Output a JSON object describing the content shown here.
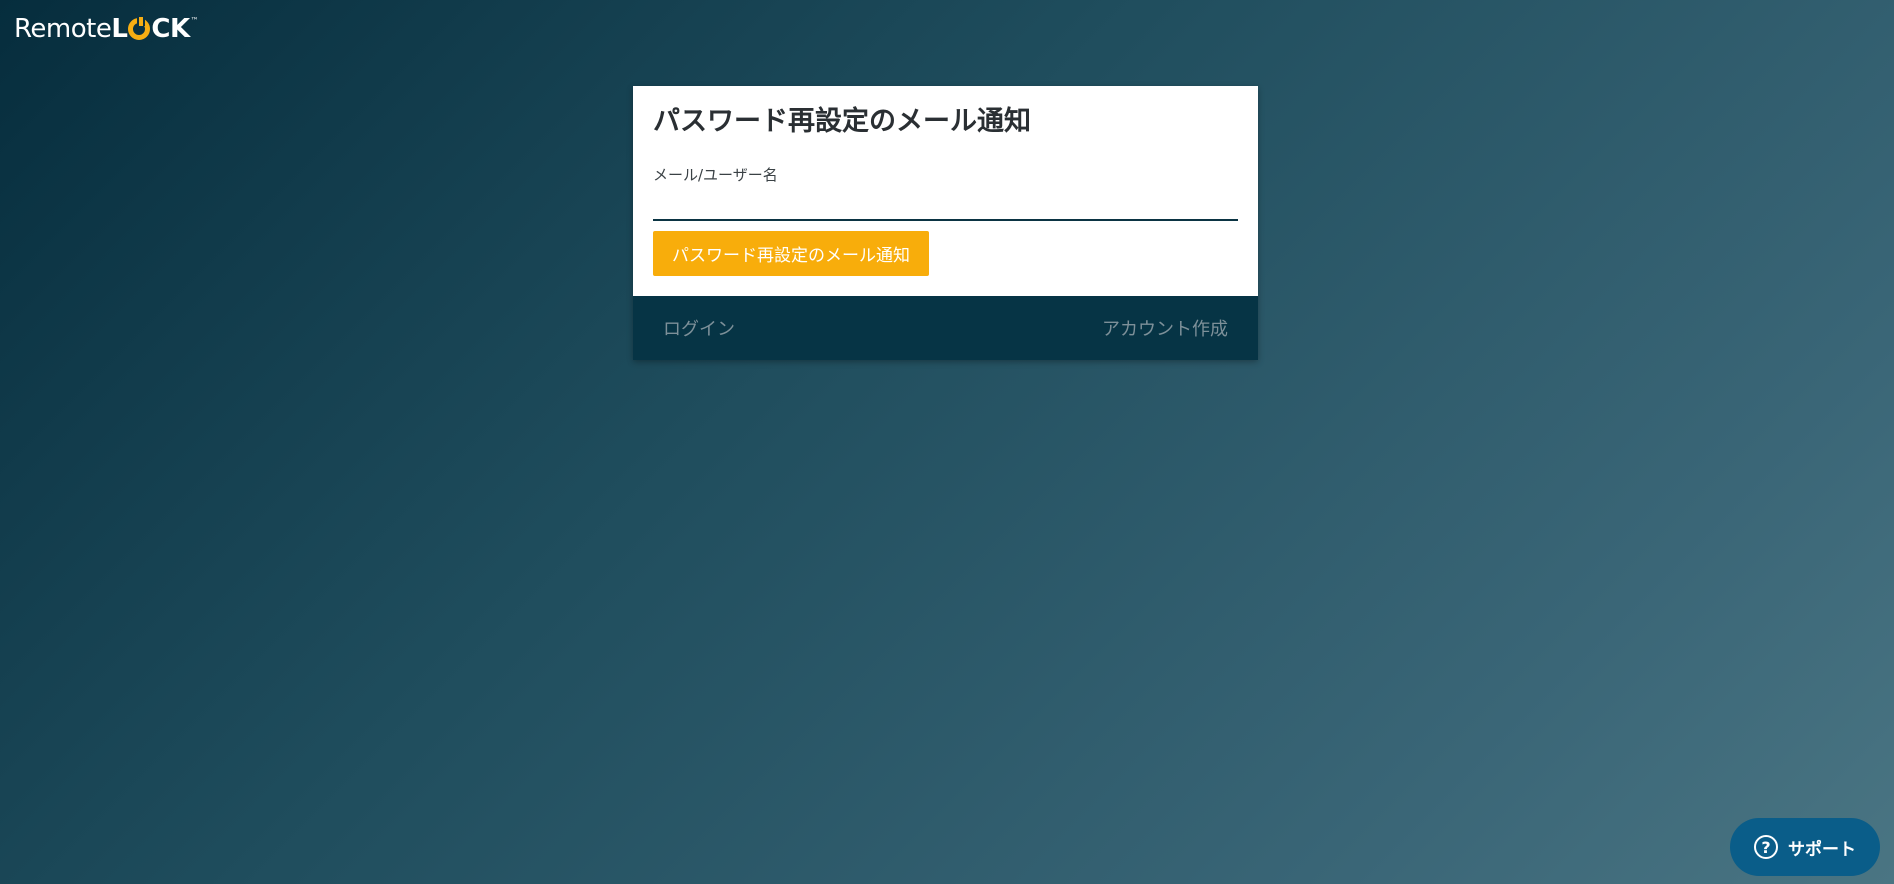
{
  "logo": {
    "remote": "Remote",
    "l": "L",
    "ck": "CK",
    "tm": "™"
  },
  "card": {
    "title": "パスワード再設定のメール通知",
    "field_label": "メール/ユーザー名",
    "field_value": "",
    "field_placeholder": "",
    "submit_label": "パスワード再設定のメール通知"
  },
  "footer": {
    "login_label": "ログイン",
    "signup_label": "アカウント作成"
  },
  "support": {
    "icon": "question-circle-icon",
    "label": "サポート"
  },
  "colors": {
    "accent": "#f8ad0b",
    "footer_bg": "#063445",
    "support_bg": "#0a5d89"
  }
}
